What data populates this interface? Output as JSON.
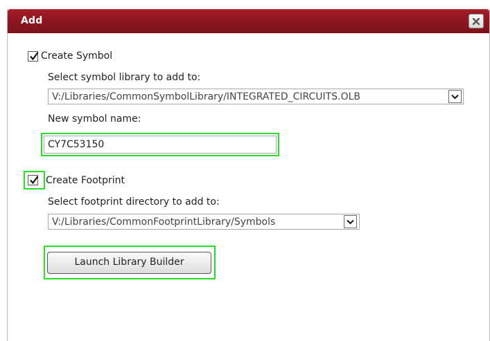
{
  "dialog": {
    "title": "Add",
    "close_icon": "close-x-icon"
  },
  "symbol": {
    "checkbox_label": "Create Symbol",
    "checked": true,
    "library_label": "Select symbol library to add to:",
    "library_value": "V:/Libraries/CommonSymbolLibrary/INTEGRATED_CIRCUITS.OLB",
    "name_label": "New symbol name:",
    "name_value": "CY7C53150"
  },
  "footprint": {
    "checkbox_label": "Create Footprint",
    "checked": true,
    "directory_label": "Select footprint directory to add to:",
    "directory_value": "V:/Libraries/CommonFootprintLibrary/Symbols"
  },
  "actions": {
    "launch_label": "Launch Library Builder"
  },
  "colors": {
    "titlebar": "#8a1620",
    "highlight": "#22e022"
  }
}
